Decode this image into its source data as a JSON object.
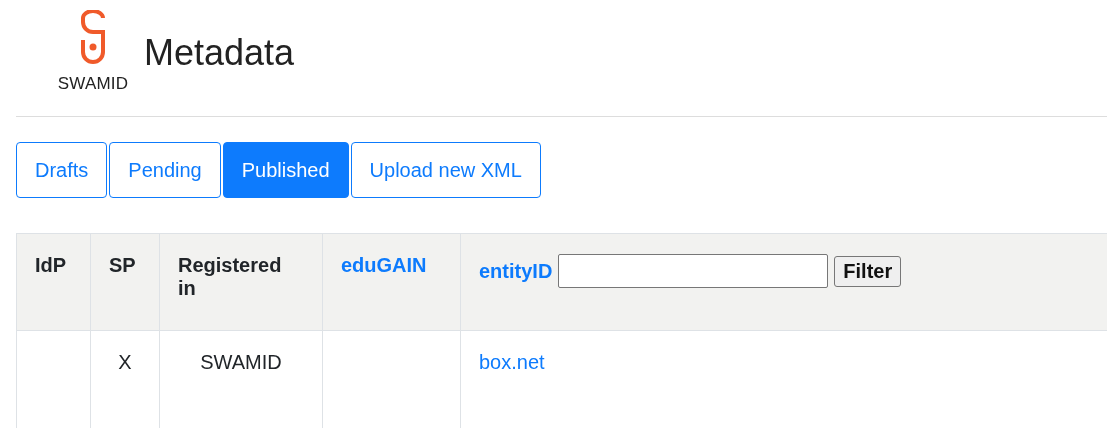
{
  "logo": {
    "text": "SWAMID"
  },
  "title": "Metadata",
  "tabs": [
    {
      "label": "Drafts",
      "selected": false
    },
    {
      "label": "Pending",
      "selected": false
    },
    {
      "label": "Published",
      "selected": true
    },
    {
      "label": "Upload new XML",
      "selected": false
    }
  ],
  "table": {
    "columns": [
      {
        "label": "IdP",
        "kind": "plain"
      },
      {
        "label": "SP",
        "kind": "plain"
      },
      {
        "label": "Registered in",
        "kind": "plain"
      },
      {
        "label": "eduGAIN",
        "kind": "link"
      },
      {
        "label": "entityID",
        "kind": "link"
      }
    ],
    "filter": {
      "button": "Filter"
    },
    "rows": [
      {
        "sp": "X",
        "registered_in": "SWAMID",
        "entity_id": "box.net"
      }
    ]
  }
}
